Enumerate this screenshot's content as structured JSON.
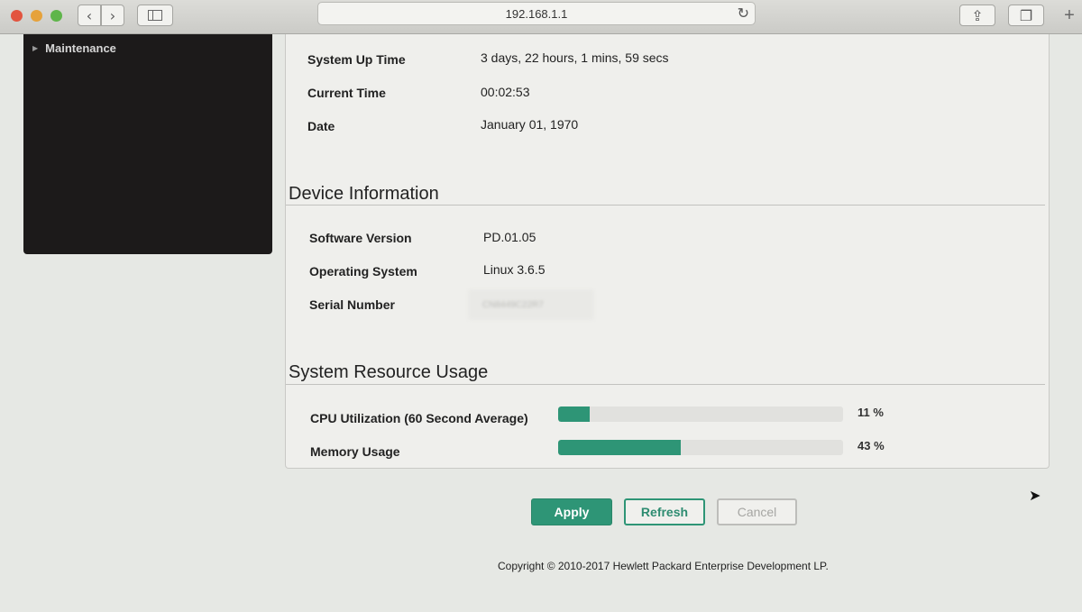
{
  "browser": {
    "url": "192.168.1.1",
    "icons": {
      "back": "chevron-left-icon",
      "forward": "chevron-right-icon",
      "reload": "reload-icon",
      "share": "share-icon",
      "tabs": "tabs-icon",
      "new_tab": "plus-icon"
    },
    "back_glyph": "‹",
    "forward_glyph": "›",
    "reload_glyph": "↻",
    "share_glyph": "⇪",
    "tabs_glyph": "❐",
    "new_tab_glyph": "+"
  },
  "sidebar": {
    "items": [
      {
        "label": "Maintenance"
      }
    ]
  },
  "system": {
    "rows": [
      {
        "label": "System Up Time",
        "value": "3 days, 22 hours, 1 mins, 59 secs"
      },
      {
        "label": "Current Time",
        "value": "00:02:53"
      },
      {
        "label": "Date",
        "value": "January 01, 1970"
      }
    ]
  },
  "device": {
    "title": "Device Information",
    "rows": [
      {
        "label": "Software Version",
        "value": "PD.01.05"
      },
      {
        "label": "Operating System",
        "value": "Linux 3.6.5"
      },
      {
        "label": "Serial Number",
        "value": "CN8449C22R7"
      }
    ]
  },
  "resources": {
    "title": "System Resource Usage",
    "items": [
      {
        "label": "CPU Utilization (60 Second Average)",
        "value": 11,
        "value_text": "11 %"
      },
      {
        "label": "Memory Usage",
        "value": 43,
        "value_text": "43 %"
      }
    ]
  },
  "actions": {
    "apply": "Apply",
    "refresh": "Refresh",
    "cancel": "Cancel"
  },
  "footer": {
    "copyright": "Copyright © 2010-2017 Hewlett Packard Enterprise Development LP."
  },
  "colors": {
    "accent": "#2e9576",
    "menu_bg": "#1c1a1a"
  }
}
